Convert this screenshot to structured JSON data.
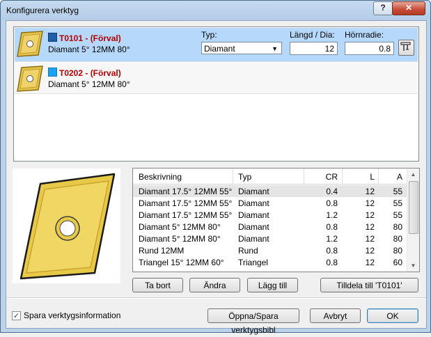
{
  "window": {
    "title": "Konfigurera verktyg",
    "help_label": "?",
    "close_label": "✕"
  },
  "tools": [
    {
      "name": "T0101 - (Förval)",
      "color": "#1f5fa8",
      "desc": "Diamant 5° 12MM 80°"
    },
    {
      "name": "T0202 - (Förval)",
      "color": "#1ea1f0",
      "desc": "Diamant 5° 12MM 80°"
    }
  ],
  "fields": {
    "type_label": "Typ:",
    "type_value": "Diamant",
    "length_label": "Längd / Dia:",
    "length_value": "12",
    "radius_label": "Hörnradie:",
    "radius_value": "0.8"
  },
  "grid": {
    "headers": [
      "Beskrivning",
      "Typ",
      "CR",
      "L",
      "A"
    ],
    "rows": [
      [
        "Diamant 17.5° 12MM 55°",
        "Diamant",
        "0.4",
        "12",
        "55"
      ],
      [
        "Diamant 17.5° 12MM 55°",
        "Diamant",
        "0.8",
        "12",
        "55"
      ],
      [
        "Diamant 17.5° 12MM 55°",
        "Diamant",
        "1.2",
        "12",
        "55"
      ],
      [
        "Diamant 5° 12MM 80°",
        "Diamant",
        "0.8",
        "12",
        "80"
      ],
      [
        "Diamant 5° 12MM 80°",
        "Diamant",
        "1.2",
        "12",
        "80"
      ],
      [
        "Rund 12MM",
        "Rund",
        "0.8",
        "12",
        "80"
      ],
      [
        "Triangel 15° 12MM 60°",
        "Triangel",
        "0.8",
        "12",
        "60"
      ]
    ]
  },
  "buttons": {
    "remove": "Ta bort",
    "edit": "Ändra",
    "add": "Lägg till",
    "assign": "Tilldela till 'T0101'",
    "library": "Öppna/Spara verktygsbibl",
    "cancel": "Avbryt",
    "ok": "OK"
  },
  "save_info": {
    "label": "Spara verktygsinformation",
    "checked": "✓"
  },
  "colors": {
    "insert_gold": "#e3c34a",
    "selection": "#b6d9fb"
  }
}
